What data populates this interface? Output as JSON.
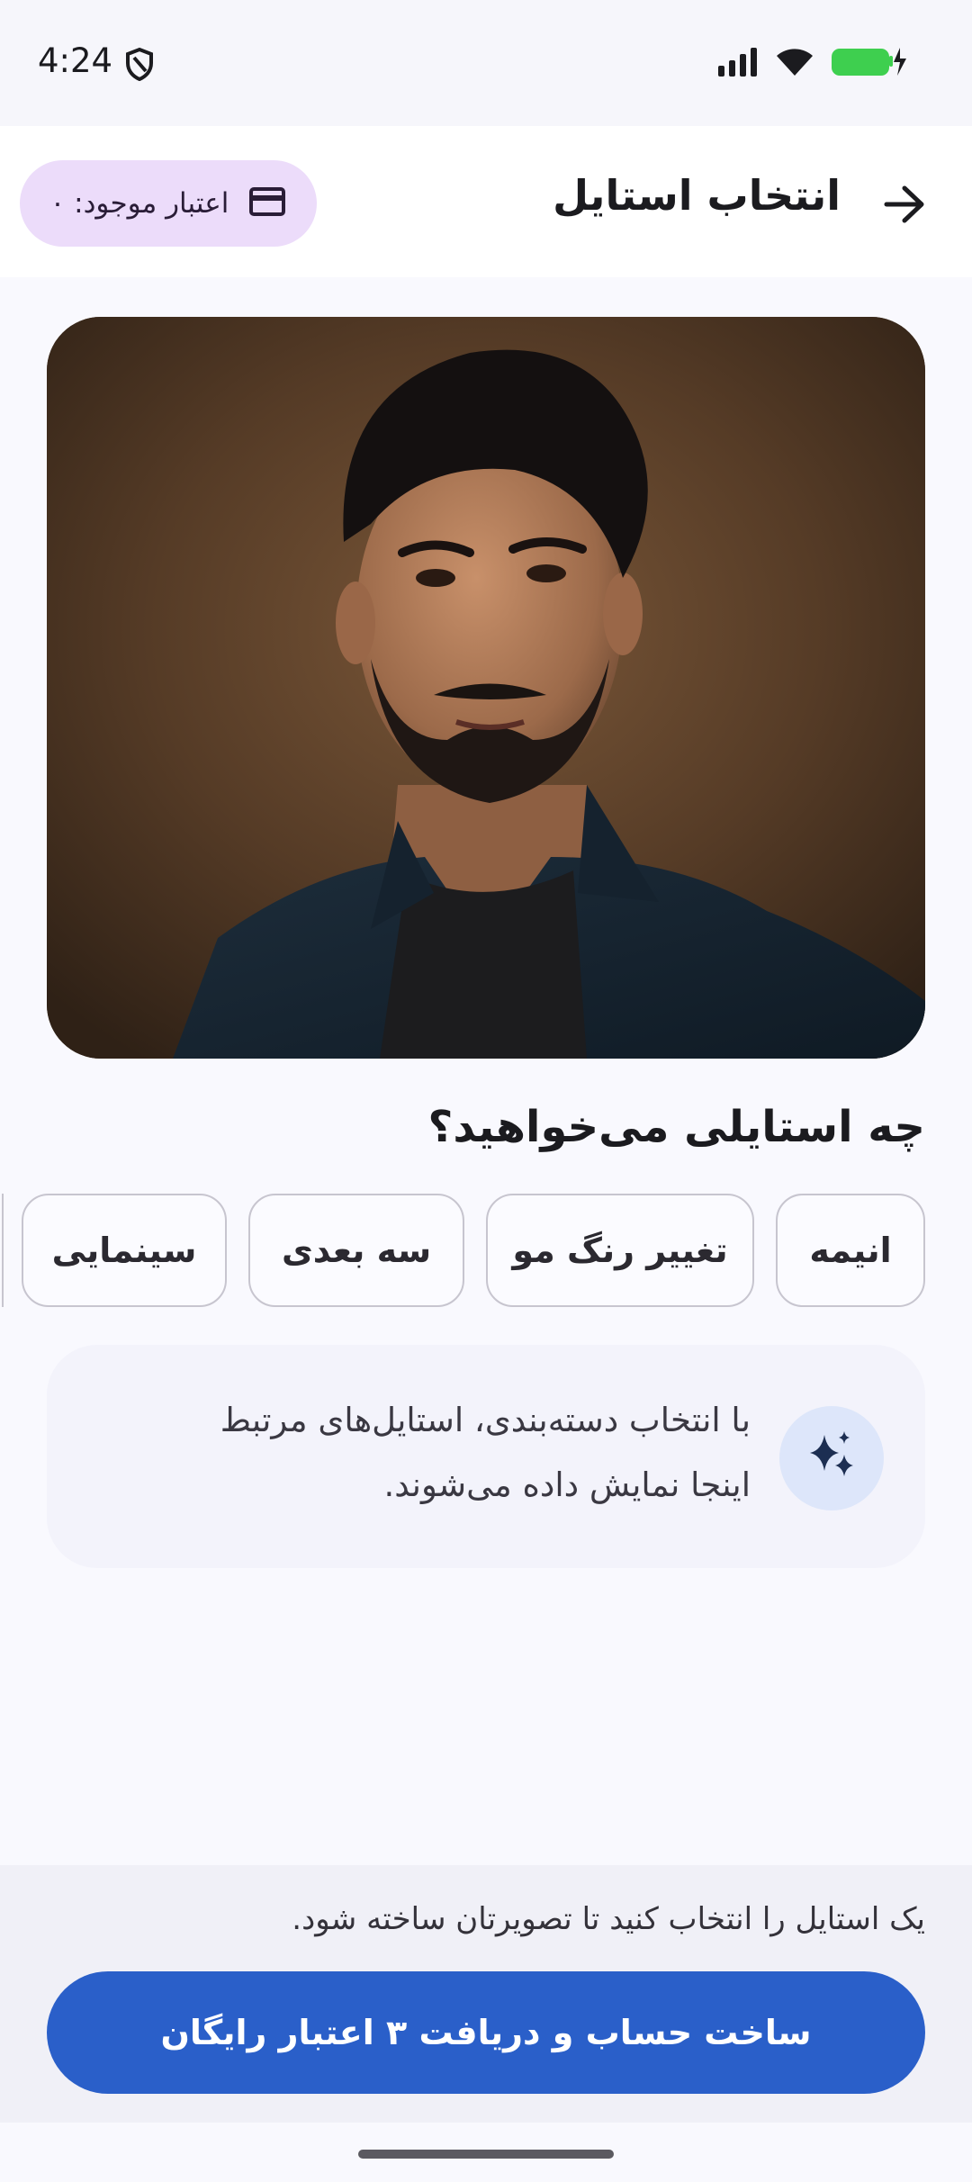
{
  "status_bar": {
    "time": "4:24",
    "icons": [
      "shield-icon",
      "signal-icon",
      "wifi-icon",
      "battery-charging-icon"
    ],
    "battery_color": "#3ecf4f"
  },
  "app_bar": {
    "title": "انتخاب استایل",
    "back_icon": "arrow-right-icon",
    "credit_label": "اعتبار موجود: ۰",
    "credit_icon": "card-icon",
    "credit_chip_color": "#ecdcfa"
  },
  "hero": {
    "image": "portrait photo"
  },
  "styles_section": {
    "heading": "چه استایلی می‌خواهید؟",
    "categories": [
      {
        "label": "انیمه"
      },
      {
        "label": "تغییر رنگ مو"
      },
      {
        "label": "سه بعدی"
      },
      {
        "label": "سینمایی"
      }
    ]
  },
  "hint": {
    "icon": "sparkles-icon",
    "line1": "با انتخاب دسته‌بندی، استایل‌های مرتبط",
    "line2": "اینجا نمایش داده می‌شوند."
  },
  "footer": {
    "note": "یک استایل را انتخاب کنید تا تصویرتان ساخته شود.",
    "cta_label": "ساخت حساب و دریافت ۳ اعتبار رایگان",
    "cta_color": "#2a5fc9"
  }
}
